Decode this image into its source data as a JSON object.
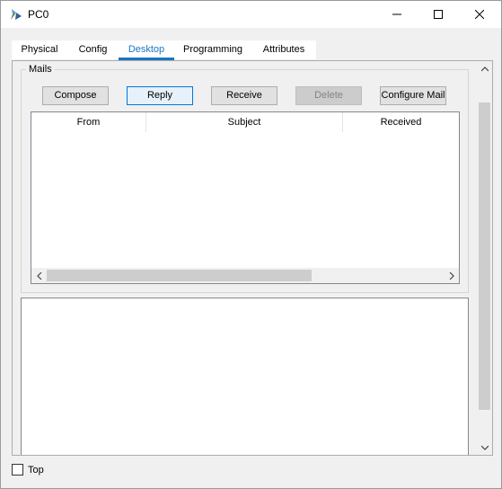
{
  "window": {
    "title": "PC0"
  },
  "tabs": [
    {
      "label": "Physical"
    },
    {
      "label": "Config"
    },
    {
      "label": "Desktop",
      "active": true
    },
    {
      "label": "Programming"
    },
    {
      "label": "Attributes"
    }
  ],
  "mail": {
    "group_label": "Mails",
    "buttons": {
      "compose": "Compose",
      "reply": "Reply",
      "receive": "Receive",
      "delete": "Delete",
      "configure": "Configure Mail"
    },
    "columns": [
      "From",
      "Subject",
      "Received"
    ]
  },
  "footer": {
    "top_label": "Top"
  },
  "colors": {
    "accent": "#1a76c4",
    "chrome": "#f0f0f0"
  }
}
